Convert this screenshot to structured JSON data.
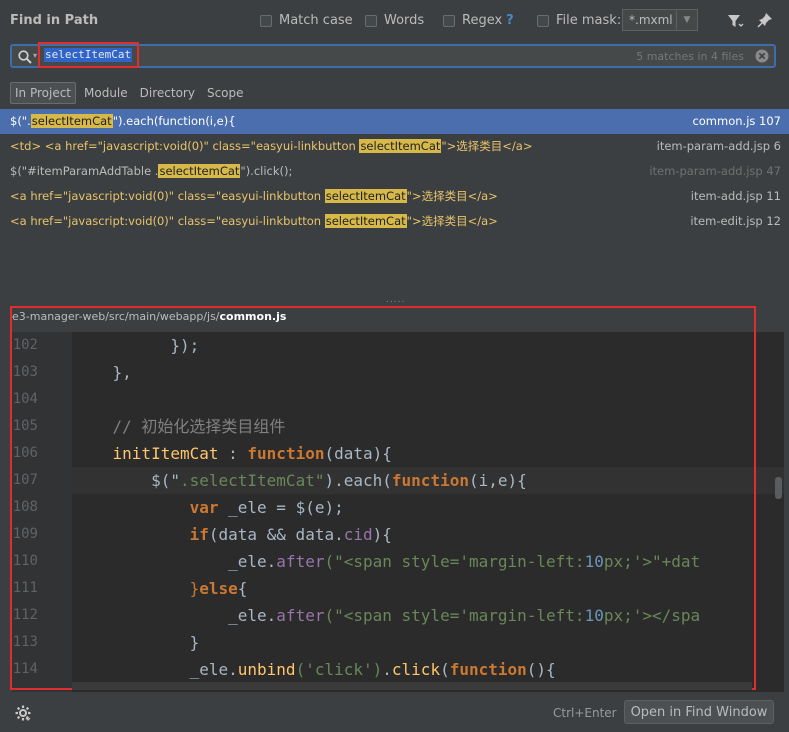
{
  "header": {
    "title": "Find in Path",
    "options": [
      {
        "label": "Match case"
      },
      {
        "label": "Words"
      },
      {
        "label": "Regex"
      },
      {
        "label": "File mask:"
      }
    ],
    "regex_help": "?",
    "file_mask_value": "*.mxml"
  },
  "search": {
    "query": "selectItemCat",
    "match_count": "5 matches in 4 files"
  },
  "scopes": [
    {
      "label": "In Project",
      "active": true
    },
    {
      "label": "Module"
    },
    {
      "label": "Directory"
    },
    {
      "label": "Scope"
    }
  ],
  "results": [
    {
      "pre": "$(\".",
      "hit": "selectItemCat",
      "post": "\").each(function(i,e){",
      "file": "common.js 107"
    },
    {
      "pre": "<td> <a href=\"javascript:void(0)\" class=\"easyui-linkbutton ",
      "hit": "selectItemCat",
      "post": "\">选择类目</a>",
      "file": "item-param-add.jsp 6"
    },
    {
      "pre": "$(\"#itemParamAddTable .",
      "hit": "selectItemCat",
      "post": "\").click();",
      "file": "item-param-add.jsp 47"
    },
    {
      "pre": "<a href=\"javascript:void(0)\" class=\"easyui-linkbutton ",
      "hit": "selectItemCat",
      "post": "\">选择类目</a>",
      "file": "item-add.jsp 11"
    },
    {
      "pre": "<a href=\"javascript:void(0)\" class=\"easyui-linkbutton ",
      "hit": "selectItemCat",
      "post": "\">选择类目</a>",
      "file": "item-edit.jsp 12"
    }
  ],
  "preview": {
    "path_prefix": "e3-manager-web/src/main/webapp/js/",
    "path_file": "common.js",
    "line_numbers": [
      "102",
      "103",
      "104",
      "105",
      "106",
      "107",
      "108",
      "109",
      "110",
      "111",
      "112",
      "113",
      "114"
    ],
    "code": {
      "l102": "});",
      "l103": "},",
      "l105_comment": "// 初始化选择类目组件",
      "l106_name": "initItemCat",
      "l106_kw": "function",
      "l106_rest": "(data){",
      "l107_a": "$(\"",
      "l107_str": ".selectItemCat\"",
      "l107_b": ").each(",
      "l107_kw": "function",
      "l107_c": "(i,e){",
      "l108_kw": "var",
      "l108_rest": " _ele = $(e);",
      "l109_kw": "if",
      "l109_a": "(data && data.",
      "l109_field": "cid",
      "l109_b": "){",
      "l110_a": "_ele.",
      "l110_m": "after",
      "l110_str1": "(\"<span style='margin-left:",
      "l110_num": "10",
      "l110_str2": "px;'>\"+dat",
      "l111_a": "}",
      "l111_kw": "else",
      "l111_b": "{",
      "l112_a": "_ele.",
      "l112_m": "after",
      "l112_str1": "(\"<span style='margin-left:",
      "l112_num": "10",
      "l112_str2": "px;'></spa",
      "l113": "}",
      "l114_a": "_ele.",
      "l114_m1": "unbind",
      "l114_s": "('click')",
      "l114_dot": ".",
      "l114_m2": "click",
      "l114_p": "(",
      "l114_kw": "function",
      "l114_end": "(){"
    }
  },
  "footer": {
    "shortcut": "Ctrl+Enter",
    "open_button": "Open in Find Window"
  }
}
